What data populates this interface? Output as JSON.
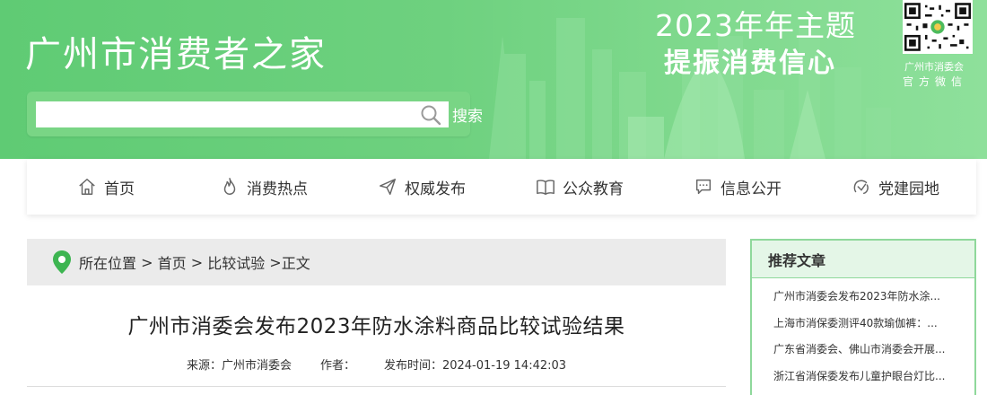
{
  "header": {
    "site_title": "广州市消费者之家",
    "theme_year": "2023年年主题",
    "theme_slogan": "提振消费信心",
    "qr_label_line1": "广州市消委会",
    "qr_label_line2": "官方微信"
  },
  "search": {
    "value": "",
    "placeholder": "",
    "button_label": "搜索"
  },
  "nav": {
    "items": [
      {
        "label": "首页",
        "icon": "home-icon"
      },
      {
        "label": "消费热点",
        "icon": "flame-icon"
      },
      {
        "label": "权威发布",
        "icon": "paper-plane-icon"
      },
      {
        "label": "公众教育",
        "icon": "book-icon"
      },
      {
        "label": "信息公开",
        "icon": "chat-bubble-icon"
      },
      {
        "label": "党建园地",
        "icon": "party-badge-icon"
      }
    ]
  },
  "breadcrumb": {
    "prefix": "所在位置",
    "home": "首页",
    "section": "比较试验",
    "current": "正文",
    "separator": " > "
  },
  "article": {
    "title": "广州市消委会发布2023年防水涂料商品比较试验结果",
    "source": "来源：广州市消委会",
    "author": "作者：",
    "published": "发布时间：2024-01-19 14:42:03"
  },
  "sidebar": {
    "heading": "推荐文章",
    "items": [
      "广州市消委会发布2023年防水涂...",
      "上海市消保委测评40款瑜伽裤：...",
      "广东省消委会、佛山市消委会开展...",
      "浙江省消保委发布儿童护眼台灯比..."
    ]
  },
  "colors": {
    "banner_green": "#6ed17f",
    "sidebar_border": "#8fd89b",
    "sidebar_head_bg": "#e4f6e7",
    "pin_green": "#3db551"
  }
}
